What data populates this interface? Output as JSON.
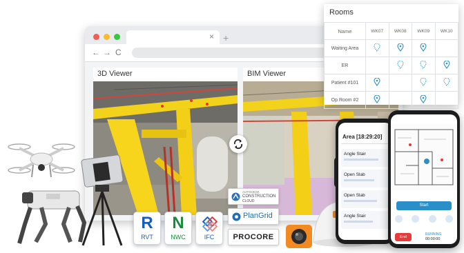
{
  "browser": {
    "traffic_colors": [
      "#f25e57",
      "#f9bc2e",
      "#36c940"
    ],
    "close_glyph": "×",
    "new_tab_glyph": "+",
    "nav": {
      "back": "←",
      "forward": "→",
      "reload": "C"
    }
  },
  "viewers": {
    "left_title": "3D Viewer",
    "right_title": "BIM Viewer"
  },
  "rooms": {
    "title": "Rooms",
    "name_header": "Name",
    "weeks": [
      "WK07",
      "WK08",
      "WK09",
      "WK10"
    ],
    "rows": [
      {
        "name": "Waiting Area",
        "marks": [
          "dashed",
          "solid",
          "solid",
          ""
        ]
      },
      {
        "name": "ER",
        "marks": [
          "",
          "dashed",
          "dashed",
          "solid"
        ]
      },
      {
        "name": "Patient #101",
        "marks": [
          "solid",
          "",
          "dashed",
          "dashed"
        ]
      },
      {
        "name": "Op Room #2",
        "marks": [
          "solid",
          "",
          "solid",
          ""
        ]
      }
    ],
    "pin_color": "#2a8fc9"
  },
  "formats": [
    {
      "letter": "R",
      "label": "RVT",
      "color": "#1a5db8"
    },
    {
      "letter": "N",
      "label": "NWC",
      "color": "#178a3c"
    },
    {
      "letter": "",
      "label": "IFC",
      "color": "#1a5db8"
    }
  ],
  "integrations": {
    "autodesk": {
      "line1": "AUTODESK",
      "line2": "CONSTRUCTION",
      "line3": "CLOUD"
    },
    "plangrid": "PlanGrid",
    "procore": "PROCORE"
  },
  "phone_left": {
    "title": "Area [18:29:20]",
    "rows": [
      "Angle Stair",
      "Open Slab",
      "Open Slab",
      "Angle Stair"
    ]
  },
  "phone_right": {
    "action": "Start",
    "status": "RUNNING",
    "end": "End",
    "time": "00:00:00"
  },
  "accent": "#ffc800"
}
